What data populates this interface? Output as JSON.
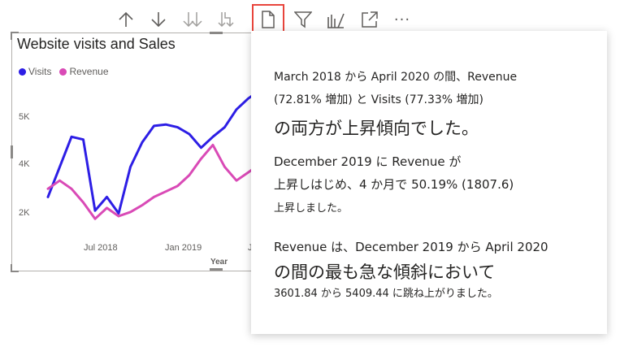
{
  "toolbar": {
    "icons": [
      "arrow-up-icon",
      "arrow-down-icon",
      "double-arrow-down-icon",
      "expand-hierarchy-icon",
      "insight-page-icon",
      "filter-icon",
      "spotlight-icon",
      "focus-mode-icon",
      "more-options-icon"
    ],
    "more_label": "···",
    "highlight_color": "#e8453c"
  },
  "visual": {
    "title": "Website visits and Sales",
    "legend": [
      {
        "label": "Visits",
        "color": "#2d1ee5"
      },
      {
        "label": "Revenue",
        "color": "#d94ab6"
      }
    ]
  },
  "chart_data": {
    "type": "line",
    "title": "Website visits and Sales",
    "xlabel": "Year",
    "ylabel": "",
    "x": [
      "2018-03",
      "2018-04",
      "2018-05",
      "2018-06",
      "2018-07",
      "2018-08",
      "2018-09",
      "2018-10",
      "2018-11",
      "2018-12",
      "2019-01",
      "2019-02",
      "2019-03",
      "2019-04",
      "2019-05",
      "2019-06",
      "2019-07",
      "2019-08",
      "2019-09"
    ],
    "x_ticks": [
      "Jul 2018",
      "Jan 2019",
      "J"
    ],
    "y_ticks": [
      "2K",
      "4K",
      "5K"
    ],
    "y_tick_values": [
      2000,
      4000,
      6000
    ],
    "ylim": [
      1000,
      7000
    ],
    "series": [
      {
        "name": "Visits",
        "color": "#2d1ee5",
        "values": [
          2800,
          3900,
          5000,
          4900,
          2300,
          2800,
          2200,
          3900,
          4800,
          5400,
          5450,
          5350,
          5100,
          4600,
          5000,
          5350,
          6000,
          6400,
          6700
        ]
      },
      {
        "name": "Revenue",
        "color": "#d94ab6",
        "values": [
          3100,
          3400,
          3100,
          2600,
          2000,
          2400,
          2100,
          2250,
          2500,
          2800,
          3000,
          3200,
          3600,
          4200,
          4700,
          3900,
          3400,
          3700,
          4000
        ]
      }
    ]
  },
  "insight": {
    "p1_line1": "March 2018 から April 2020 の間、Revenue",
    "p1_line2": "(72.81% 増加) と Visits (77.33% 増加)",
    "p1_line3": "の両方が上昇傾向でした。",
    "p2_line1": "December 2019 に Revenue が",
    "p2_line2": "上昇しはじめ、4 か月で 50.19% (1807.6)",
    "p2_line3": "上昇しました。",
    "p3_line1": "Revenue は、December 2019 から April 2020",
    "p3_line2": "の間の最も急な傾斜において",
    "p3_line3": "3601.84 から 5409.44 に跳ね上がりました。"
  }
}
